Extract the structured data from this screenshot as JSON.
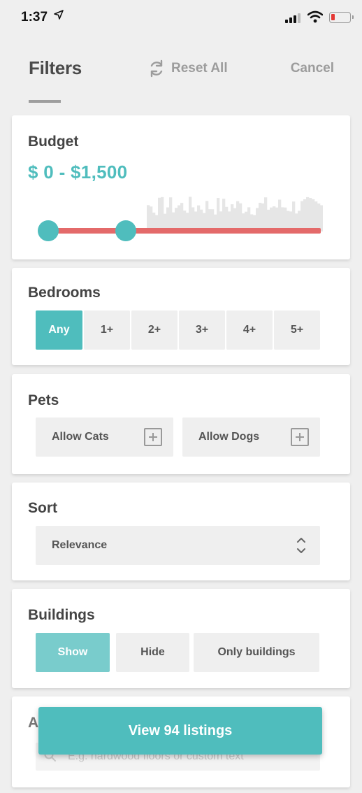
{
  "status_bar": {
    "time": "1:37",
    "location_icon": "location-arrow-icon"
  },
  "header": {
    "tab_title": "Filters",
    "reset_label": "Reset All",
    "reset_icon": "refresh-icon",
    "cancel_label": "Cancel"
  },
  "budget": {
    "title": "Budget",
    "range": "$ 0  -  $1,500",
    "min_fraction": 0.0,
    "max_fraction": 0.29
  },
  "bedrooms": {
    "title": "Bedrooms",
    "options": [
      "Any",
      "1+",
      "2+",
      "3+",
      "4+",
      "5+"
    ],
    "selected": "Any"
  },
  "pets": {
    "title": "Pets",
    "options": [
      "Allow Cats",
      "Allow Dogs"
    ],
    "icon": "plus-square-icon"
  },
  "sort": {
    "title": "Sort",
    "value": "Relevance",
    "icon": "chevron-up-down-icon"
  },
  "buildings": {
    "title": "Buildings",
    "options": [
      "Show",
      "Hide",
      "Only buildings"
    ],
    "selected": "Show"
  },
  "amenities": {
    "title": "A",
    "placeholder": "E.g. hardwood floors or custom text",
    "icon": "search-icon"
  },
  "footer": {
    "view_button": "View 94 listings"
  },
  "colors": {
    "accent": "#4fbdbd",
    "slider_track": "#e46a6a",
    "background": "#efefef"
  }
}
